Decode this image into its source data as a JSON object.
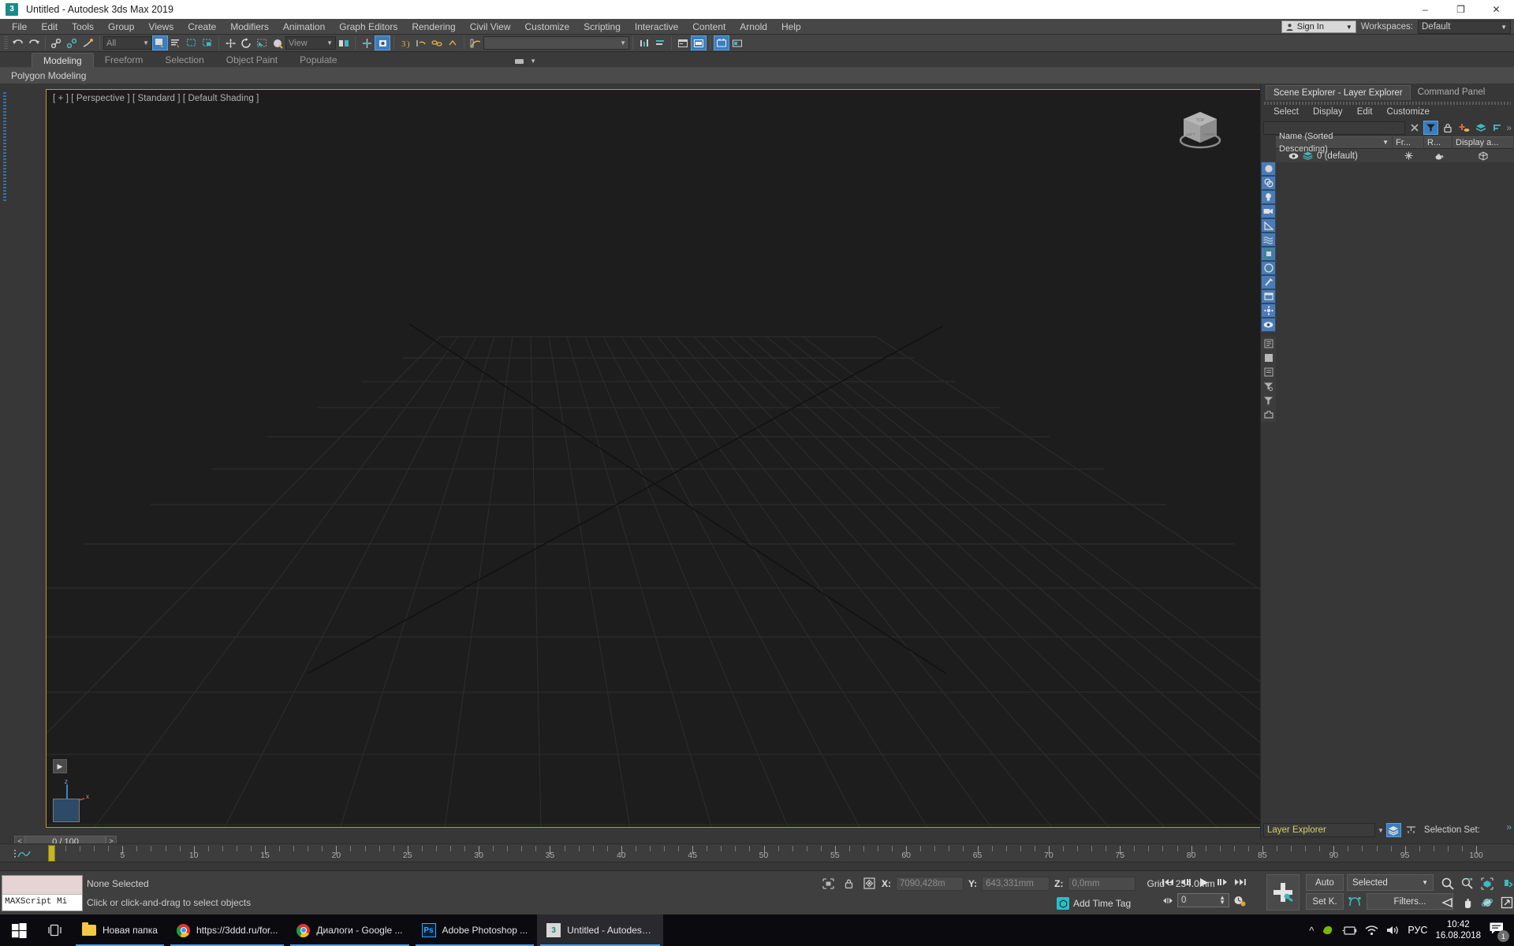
{
  "window": {
    "title": "Untitled - Autodesk 3ds Max 2019",
    "app_icon": "3dsmax-icon",
    "minimize": "–",
    "maximize": "❐",
    "close": "✕"
  },
  "menubar": {
    "items": [
      "File",
      "Edit",
      "Tools",
      "Group",
      "Views",
      "Create",
      "Modifiers",
      "Animation",
      "Graph Editors",
      "Rendering",
      "Civil View",
      "Customize",
      "Scripting",
      "Interactive",
      "Content",
      "Arnold",
      "Help"
    ],
    "signin_label": "Sign In",
    "workspaces_label": "Workspaces:",
    "workspace_value": "Default"
  },
  "toolbar": {
    "undo": "undo-icon",
    "redo": "redo-icon",
    "select_filter": "All",
    "ref_coord_sys": "View",
    "named_selection_set": "",
    "buttons": [
      "select-link-icon",
      "unlink-icon",
      "bind-spacewarp-icon",
      "select-object-icon",
      "select-by-name-icon",
      "rect-selection-icon",
      "window-crossing-icon",
      "select-move-icon",
      "select-rotate-icon",
      "select-scale-icon",
      "select-place-icon",
      "mirror-icon",
      "align-icon",
      "layer-explorer-icon",
      "curve-editor-icon",
      "schematic-view-icon",
      "material-editor-icon",
      "render-setup-icon",
      "render-frame-icon",
      "render-production-icon"
    ]
  },
  "ribbon": {
    "tabs": [
      "Modeling",
      "Freeform",
      "Selection",
      "Object Paint",
      "Populate"
    ],
    "active_tab": "Modeling",
    "subtitle": "Polygon Modeling"
  },
  "viewport": {
    "label": "[ + ] [ Perspective ] [ Standard ] [ Default Shading ]",
    "viewcube": "viewcube-icon",
    "grid_color": "#2b2b2b",
    "border_color": "#bf9a36",
    "background": "#1d1d1d"
  },
  "time_slider": {
    "prev": "<",
    "value": "0 / 100",
    "next": ">"
  },
  "track_bar": {
    "current_frame": 0,
    "ticks": [
      0,
      5,
      10,
      15,
      20,
      25,
      30,
      35,
      40,
      45,
      50,
      55,
      60,
      65,
      70,
      75,
      80,
      85,
      90,
      95,
      100
    ],
    "range_start": 0,
    "range_end": 100
  },
  "scene_explorer": {
    "tabs": [
      "Scene Explorer - Layer Explorer",
      "Command Panel"
    ],
    "active_tab": "Scene Explorer - Layer Explorer",
    "menus": [
      "Select",
      "Display",
      "Edit",
      "Customize"
    ],
    "search_placeholder": "",
    "search_value": "",
    "clear_icon": "close-icon",
    "filter_icon": "filter-icon",
    "lock_icon": "lock-icon",
    "add_layer_icon": "add-layer-icon",
    "layer_stack_icon": "layer-stack-icon",
    "sort_icon": "sort-icon",
    "overflow": "»",
    "columns": [
      "Name (Sorted Descending)",
      "Fr...",
      "R...",
      "Display a..."
    ],
    "rows": [
      {
        "name": "0 (default)",
        "visibility": "eye-icon",
        "icon": "layers-icon",
        "frozen": "snowflake-icon",
        "render": "teapot-icon",
        "display": "cube-icon"
      }
    ],
    "left_toolbar": [
      "geometry-filter-icon",
      "shapes-filter-icon",
      "lights-filter-icon",
      "cameras-filter-icon",
      "helpers-filter-icon",
      "spacewarps-filter-icon",
      "groups-filter-icon",
      "xrefs-filter-icon",
      "bones-filter-icon",
      "containers-filter-icon",
      "particles-filter-icon",
      "visibility-icon",
      "column-list-icon",
      "panel-icon",
      "list-icon",
      "filter-funnel-icon",
      "funnel-icon",
      "toolbar-icon"
    ],
    "footer_layer": "Layer Explorer",
    "footer_layer_icon": "layers-icon",
    "footer_toolbar_icon": "toolbar-icon",
    "selection_set_label": "Selection Set:",
    "footer_overflow": "»"
  },
  "status_bar": {
    "maxscript_label": "MAXScript Mi",
    "status_line1": "None Selected",
    "status_line2": "Click or click-and-drag to select objects",
    "isolate_icon": "isolate-selection-icon",
    "lock_icon": "lock-selection-icon",
    "absolute_icon": "absolute-mode-icon",
    "x_label": "X:",
    "x_value": "7090,428m",
    "y_label": "Y:",
    "y_value": "643,331mm",
    "z_label": "Z:",
    "z_value": "0,0mm",
    "grid_text": "Grid = 254.0mm",
    "add_time_tag": "Add Time Tag"
  },
  "anim_controls": {
    "go_to_start": "⏮",
    "prev_frame": "⏴❙",
    "play": "▶",
    "next_frame": "❙⏵",
    "go_to_end": "⏭",
    "key_mode": "key-mode-icon",
    "frame_value": "0",
    "time_config_icon": "time-config-icon",
    "set_key_big": "set-key-button",
    "auto_label": "Auto",
    "set_key_label": "Set K.",
    "key_filter_selected": "Selected",
    "key_filters": "Filters...",
    "key_toggle_icon": "key-toggle-icon",
    "nav": [
      "zoom-icon",
      "zoom-all-icon",
      "zoom-extents-icon",
      "zoom-region-icon",
      "field-of-view-icon",
      "pan-icon",
      "orbit-icon",
      "maximize-viewport-icon"
    ]
  },
  "taskbar": {
    "start_icon": "windows-start-icon",
    "task_view_icon": "task-view-icon",
    "apps": [
      {
        "label": "Новая папка",
        "icon": "folder-icon",
        "active": false
      },
      {
        "label": "https://3ddd.ru/for...",
        "icon": "chrome-icon",
        "active": false
      },
      {
        "label": "Диалоги - Google ...",
        "icon": "chrome-icon",
        "active": false
      },
      {
        "label": "Adobe Photoshop ...",
        "icon": "photoshop-icon",
        "active": false
      },
      {
        "label": "Untitled - Autodesk...",
        "icon": "3dsmax-icon",
        "active": true
      }
    ],
    "tray": {
      "chevron": "^",
      "icons": [
        "nvidia-icon",
        "battery-icon",
        "wifi-icon",
        "volume-icon"
      ],
      "language": "РУС",
      "time": "10:42",
      "date": "16.08.2018",
      "notifications_count": "1"
    }
  },
  "colors": {
    "accent": "#3a7ebf",
    "viewport_border": "#bf9a36",
    "panel_bg": "#373737",
    "toolbar_bg": "#444444",
    "teal": "#2bbfc7",
    "key_yellow": "#c3b432"
  }
}
